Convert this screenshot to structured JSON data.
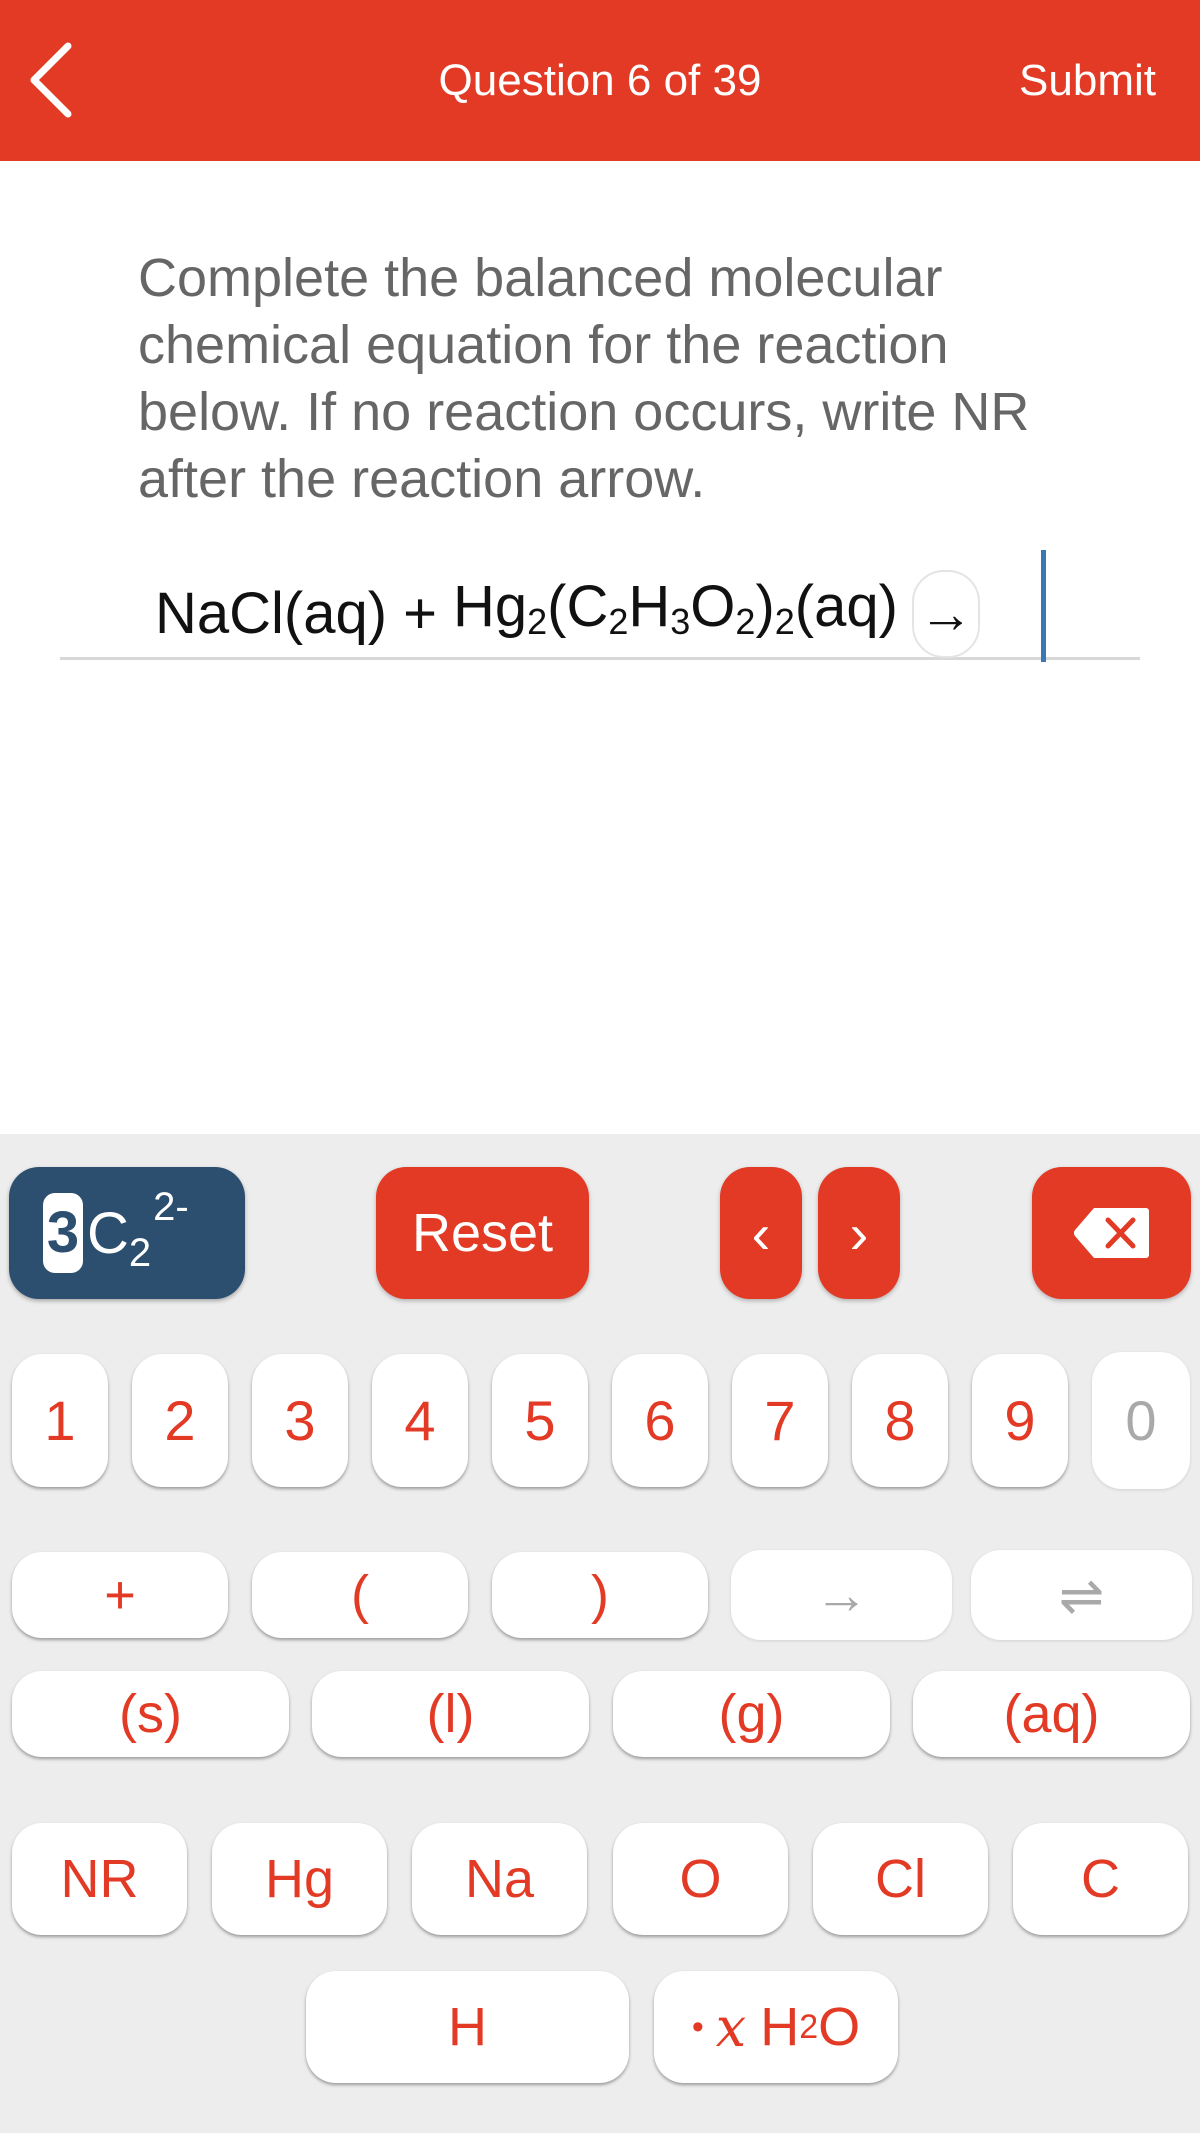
{
  "header": {
    "back_icon": "chevron-left-icon",
    "title": "Question 6 of 39",
    "submit_label": "Submit",
    "color": "#e23a25"
  },
  "question": {
    "prompt": "Complete the balanced molecular chemical equation for the reaction below. If no reaction occurs, write NR after the reaction arrow.",
    "equation": {
      "reactant1": "NaCl(aq)",
      "plus": "+",
      "reactant2_parts": [
        "Hg",
        "2",
        "(C",
        "2",
        "H",
        "3",
        "O",
        "2",
        ")",
        "2",
        "(aq)"
      ],
      "arrow": "→",
      "answer_value": ""
    }
  },
  "keypad": {
    "formula_display": {
      "coefficient": "3",
      "element": "C",
      "subscript": "2",
      "charge": "2-"
    },
    "reset_label": "Reset",
    "cursor_left_icon": "‹",
    "cursor_right_icon": "›",
    "backspace_icon": "backspace-icon",
    "digits": [
      {
        "label": "1",
        "enabled": true
      },
      {
        "label": "2",
        "enabled": true
      },
      {
        "label": "3",
        "enabled": true
      },
      {
        "label": "4",
        "enabled": true
      },
      {
        "label": "5",
        "enabled": true
      },
      {
        "label": "6",
        "enabled": true
      },
      {
        "label": "7",
        "enabled": true
      },
      {
        "label": "8",
        "enabled": true
      },
      {
        "label": "9",
        "enabled": true
      },
      {
        "label": "0",
        "enabled": false
      }
    ],
    "symbols": [
      {
        "label": "+",
        "enabled": true
      },
      {
        "label": "(",
        "enabled": true
      },
      {
        "label": ")",
        "enabled": true
      },
      {
        "label": "→",
        "enabled": false
      },
      {
        "label": "⇌",
        "enabled": false
      }
    ],
    "states": [
      "(s)",
      "(l)",
      "(g)",
      "(aq)"
    ],
    "elements": [
      "NR",
      "Hg",
      "Na",
      "O",
      "Cl",
      "C"
    ],
    "last_row": {
      "h_label": "H",
      "hydrate": {
        "dot": "•",
        "x": "x",
        "h": "H",
        "sub": "2",
        "o": "O"
      }
    },
    "accent_color": "#e23a25",
    "display_color": "#2c4f70",
    "disabled_color": "#a9a9a9"
  }
}
